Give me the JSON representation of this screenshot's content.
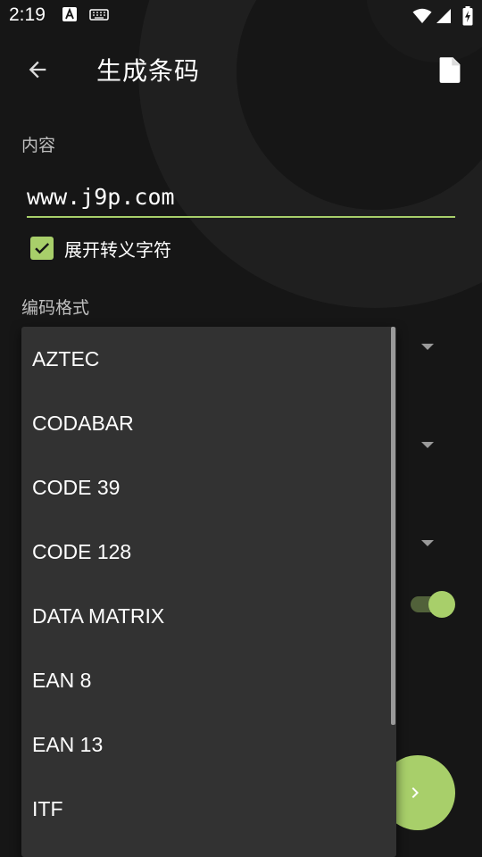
{
  "status": {
    "time": "2:19"
  },
  "appbar": {
    "title": "生成条码"
  },
  "form": {
    "content_label": "内容",
    "content_value": "www.j9p.com",
    "escape_checkbox_label": "展开转义字符",
    "escape_checked": true,
    "format_label": "编码格式"
  },
  "dropdown": {
    "items": [
      "AZTEC",
      "CODABAR",
      "CODE 39",
      "CODE 128",
      "DATA MATRIX",
      "EAN 8",
      "EAN 13",
      "ITF"
    ]
  },
  "colors": {
    "accent": "#a8cf6a",
    "background": "#161616",
    "menu": "#323232"
  }
}
